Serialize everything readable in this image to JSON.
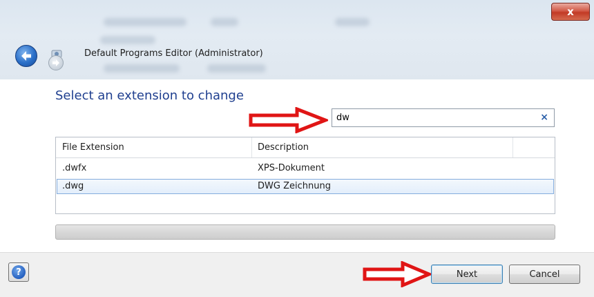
{
  "window": {
    "title": "Default Programs Editor (Administrator)",
    "close_label": "x"
  },
  "main": {
    "heading": "Select an extension to change",
    "search": {
      "value": "dw",
      "clear_label": "×"
    },
    "list": {
      "columns": [
        "File Extension",
        "Description"
      ],
      "rows": [
        {
          "extension": ".dwfx",
          "description": "XPS-Dokument",
          "selected": false
        },
        {
          "extension": ".dwg",
          "description": "DWG Zeichnung",
          "selected": true
        }
      ]
    },
    "progress_fraction": 0
  },
  "footer": {
    "help_label": "?",
    "next_label": "Next",
    "cancel_label": "Cancel"
  },
  "icons": {
    "back": "back-arrow-icon",
    "forward": "forward-arrow-icon",
    "app": "app-icon",
    "close": "close-icon",
    "help": "help-icon",
    "annotation": "red-arrow-icon"
  },
  "colors": {
    "heading": "#1f3f8f",
    "annotation_arrow": "#e01515",
    "close_button": "#c23a25",
    "selection_border": "#84acdd"
  }
}
